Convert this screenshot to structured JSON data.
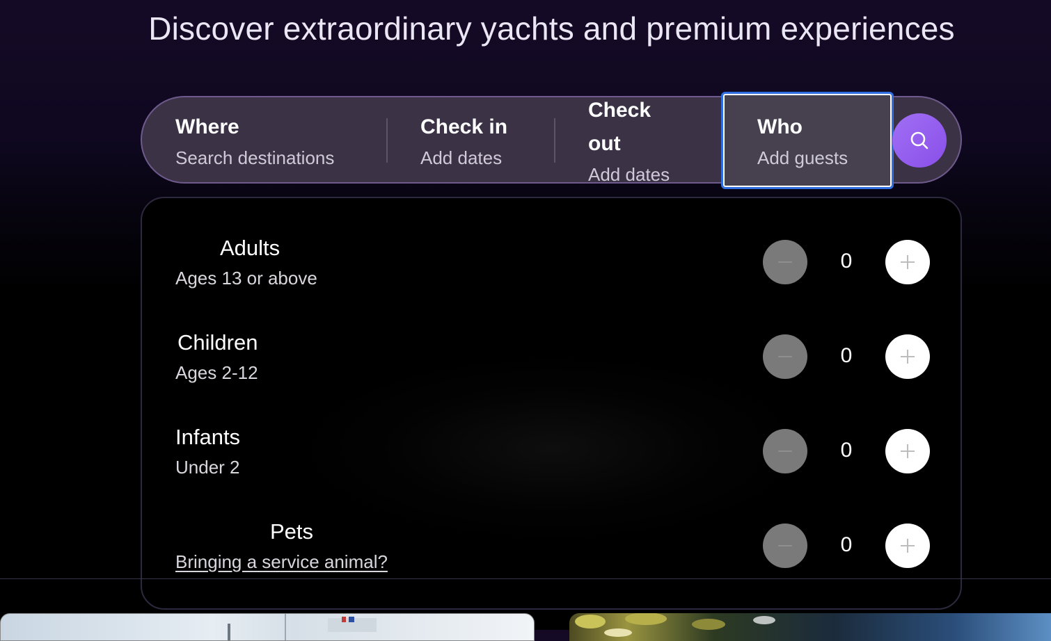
{
  "hero": {
    "title": "Discover extraordinary yachts and premium experiences"
  },
  "search": {
    "where": {
      "title": "Where",
      "placeholder": "Search destinations"
    },
    "check_in": {
      "title": "Check in",
      "placeholder": "Add dates"
    },
    "check_out": {
      "title_line1": "Check",
      "title_line2": "out",
      "placeholder": "Add dates"
    },
    "who": {
      "title": "Who",
      "placeholder": "Add guests"
    },
    "button_icon": "search-icon"
  },
  "guests": {
    "rows": [
      {
        "label": "Adults",
        "sub": "Ages 13 or above",
        "count": "0"
      },
      {
        "label": "Children",
        "sub": "Ages 2-12",
        "count": "0"
      },
      {
        "label": "Infants",
        "sub": "Under 2",
        "count": "0"
      },
      {
        "label": "Pets",
        "sub": "Bringing a service animal?",
        "count": "0"
      }
    ]
  },
  "colors": {
    "accent": "#9b63f2",
    "focus_ring": "#2f6ee0",
    "minus_disabled": "#7a7a7a"
  }
}
